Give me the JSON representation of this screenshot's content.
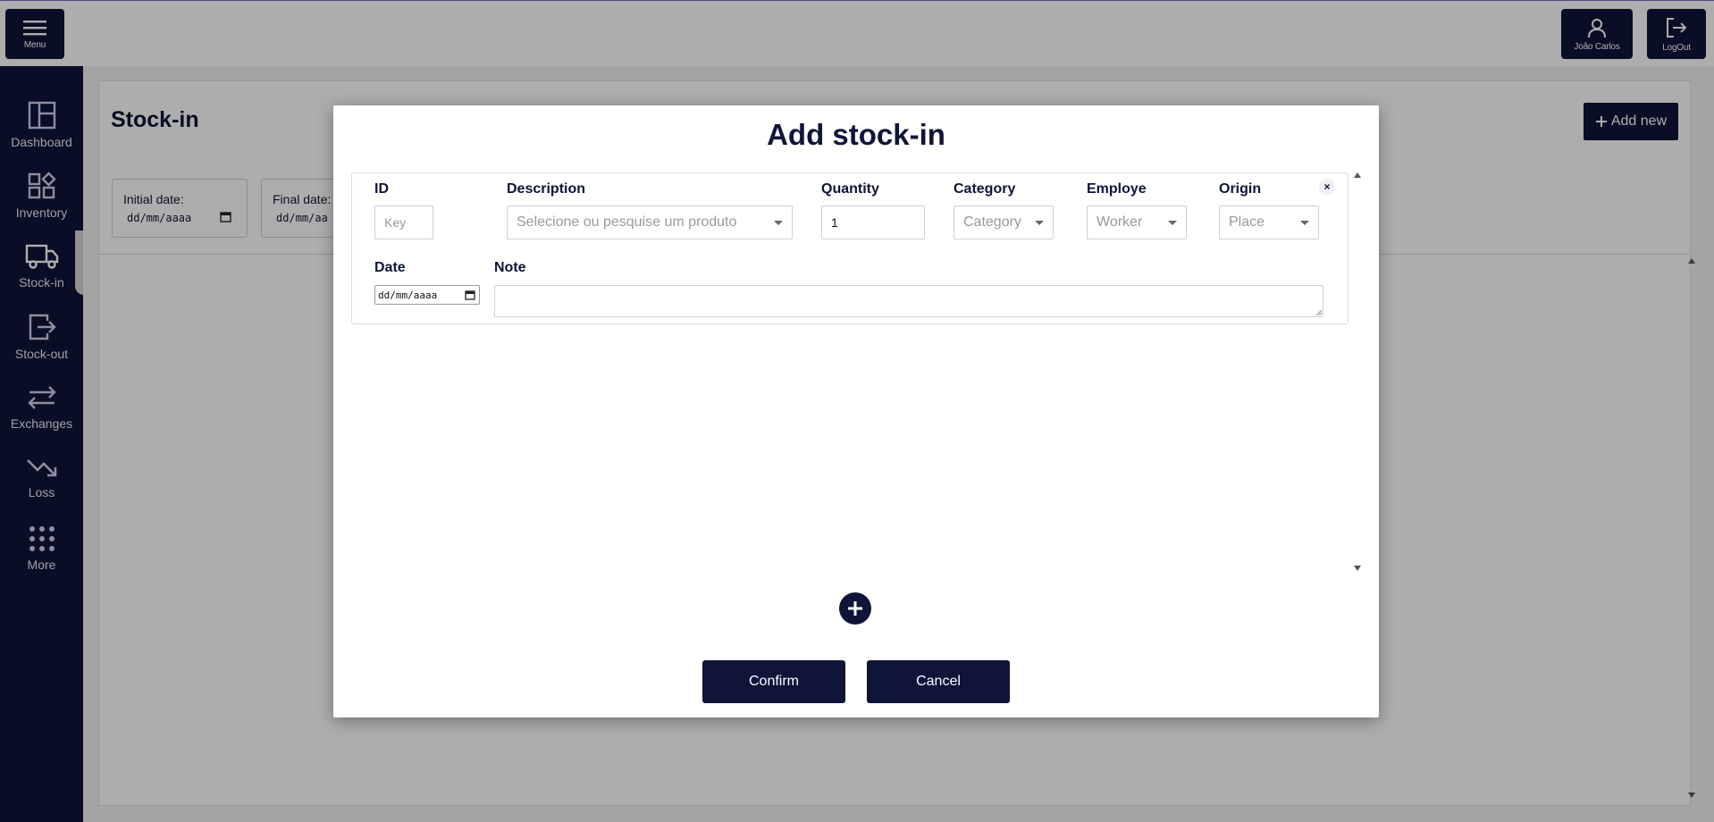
{
  "topbar": {
    "menu_label": "Menu",
    "user_label": "João Carlos",
    "logout_label": "LogOut"
  },
  "sidebar": {
    "items": [
      {
        "label": "Dashboard",
        "icon": "dashboard-icon"
      },
      {
        "label": "Inventory",
        "icon": "inventory-icon"
      },
      {
        "label": "Stock-in",
        "icon": "truck-icon",
        "active": true
      },
      {
        "label": "Stock-out",
        "icon": "exit-icon"
      },
      {
        "label": "Exchanges",
        "icon": "exchange-icon"
      },
      {
        "label": "Loss",
        "icon": "trending-down-icon"
      },
      {
        "label": "More",
        "icon": "grid-dots-icon"
      }
    ]
  },
  "page": {
    "title": "Stock-in",
    "add_new_label": "Add new",
    "filters": [
      {
        "label": "Initial date:",
        "value": "dd/mm/aaaa"
      },
      {
        "label": "Final date:",
        "value": "dd/mm/aa"
      }
    ]
  },
  "modal": {
    "title": "Add stock-in",
    "labels": {
      "id": "ID",
      "description": "Description",
      "quantity": "Quantity",
      "category": "Category",
      "employe": "Employe",
      "origin": "Origin",
      "date": "Date",
      "note": "Note"
    },
    "fields": {
      "id_placeholder": "Key",
      "description_placeholder": "Selecione ou pesquise um produto",
      "quantity_value": "1",
      "category_placeholder": "Category",
      "employe_placeholder": "Worker",
      "origin_placeholder": "Place",
      "date_value": "dd/mm/aaaa",
      "note_value": ""
    },
    "close_symbol": "×",
    "confirm_label": "Confirm",
    "cancel_label": "Cancel"
  },
  "colors": {
    "primary": "#0e1539",
    "overlay": "rgba(0,0,0,0.32)"
  }
}
